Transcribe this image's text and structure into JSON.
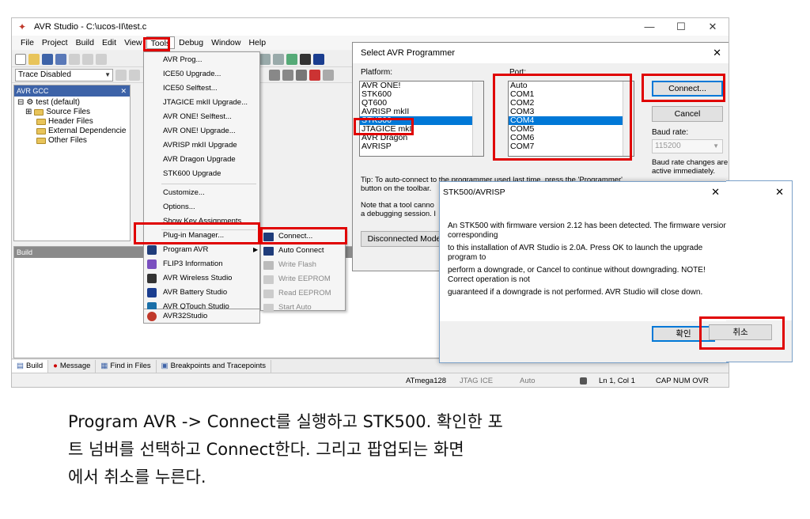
{
  "window": {
    "title": "AVR Studio - C:\\ucos-II\\test.c",
    "minimize": "—",
    "maximize": "☐",
    "close": "✕"
  },
  "menubar": [
    "File",
    "Project",
    "Build",
    "Edit",
    "View",
    "Tools",
    "Debug",
    "Window",
    "Help"
  ],
  "toolbar": {
    "trace_combo": "Trace Disabled"
  },
  "left_panel": {
    "header": "AVR GCC",
    "tree": [
      "test (default)",
      "Source Files",
      "Header Files",
      "External Dependencie",
      "Other Files"
    ]
  },
  "build_panel": {
    "header": "Build"
  },
  "tools_menu": {
    "items": [
      "AVR Prog...",
      "ICE50 Upgrade...",
      "ICE50 Selftest...",
      "JTAGICE mkII Upgrade...",
      "AVR ONE! Selftest...",
      "AVR ONE! Upgrade...",
      "AVRISP mkII Upgrade",
      "AVR Dragon Upgrade",
      "STK600 Upgrade",
      "Customize...",
      "Options...",
      "Show Key Assignments",
      "Plug-in Manager...",
      "Program AVR",
      "FLIP3 Information",
      "AVR Wireless Studio",
      "AVR Battery Studio",
      "AVR QTouch Studio",
      "AVR32Studio"
    ]
  },
  "program_avr_submenu": {
    "items": [
      "Connect...",
      "Auto Connect",
      "Write Flash",
      "Write EEPROM",
      "Read EEPROM",
      "Start Auto"
    ]
  },
  "programmer_dialog": {
    "title": "Select AVR Programmer",
    "platform_label": "Platform:",
    "platforms": [
      "AVR ONE!",
      "STK600",
      "QT600",
      "AVRISP mkII",
      "STK500",
      "JTAGICE mkII",
      "AVR Dragon",
      "AVRISP"
    ],
    "selected_platform": "STK500",
    "port_label": "Port:",
    "ports": [
      "Auto",
      "COM1",
      "COM2",
      "COM3",
      "COM4",
      "COM5",
      "COM6",
      "COM7"
    ],
    "selected_port": "COM4",
    "connect_button": "Connect...",
    "cancel_button": "Cancel",
    "baud_label": "Baud rate:",
    "baud_value": "115200",
    "baud_note_1": "Baud rate changes are",
    "baud_note_2": "active immediately.",
    "tip_1": "Tip: To auto-connect to the programmer used last time, press the 'Programmer'",
    "tip_2": "button on the toolbar.",
    "note_1": "Note that a tool canno",
    "note_2": "a debugging session. I",
    "disconnected_button": "Disconnected Mode"
  },
  "confirm_dialog": {
    "title": "STK500/AVRISP",
    "close": "✕",
    "lines": [
      "An STK500 with firmware version 2.12 has been detected. The firmware version",
      "corresponding",
      "to this installation of AVR Studio is 2.0A. Press OK to launch the upgrade",
      "program to",
      "perform a downgrade, or Cancel to continue without downgrading. NOTE!",
      "Correct operation is not",
      "guaranteed if a downgrade is not performed.  AVR Studio will close down."
    ],
    "ok_button": "확인",
    "cancel_button": "취소"
  },
  "bottom_tabs": [
    "Build",
    "Message",
    "Find in Files",
    "Breakpoints and Tracepoints"
  ],
  "status_bar": {
    "device": "ATmega128",
    "tool": "JTAG ICE",
    "mode": "Auto",
    "position": "Ln 1, Col 1",
    "keys": "CAP  NUM  OVR"
  },
  "caption": {
    "line1": "Program AVR -> Connect를 실행하고 STK500. 확인한 포",
    "line2": "트 넘버를 선택하고 Connect한다. 그리고 팝업되는 화면",
    "line3": "에서 취소를 누른다."
  },
  "colors": {
    "highlight": "#e00000",
    "selection": "#0078d7",
    "panel_header": "#3d63a8"
  }
}
